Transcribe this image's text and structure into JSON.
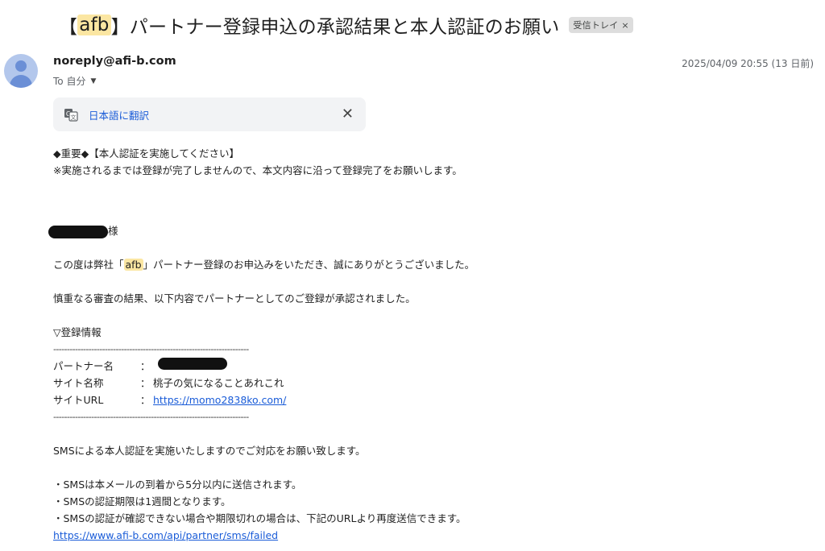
{
  "subject": {
    "prefix": "【",
    "highlight": "afb",
    "rest": "】パートナー登録申込の承認結果と本人認証のお願い",
    "label": "受信トレイ",
    "label_close": "×"
  },
  "sender": {
    "email": "noreply@afi-b.com",
    "to_label": "To 自分",
    "date": "2025/04/09 20:55 (13 日前)"
  },
  "translate": {
    "link_text": "日本語に翻訳",
    "close": "✕"
  },
  "body": {
    "line1": "◆重要◆【本人認証を実施してください】",
    "line2": "※実施されるまでは登録が完了しませんので、本文内容に沿って登録完了をお願いします。",
    "greeting_suffix": "様",
    "thanks_pre": "この度は弊社「",
    "thanks_hl": "afb",
    "thanks_post": "」パートナー登録のお申込みをいただき、誠にありがとうございました。",
    "approved": "慎重なる審査の結果、以下内容でパートナーとしてのご登録が承認されました。",
    "reg_header": "▽登録情報",
    "dashes": "------------------------------------------------------------------------",
    "rows": [
      {
        "key": "パートナー名",
        "sep": "：",
        "value": ""
      },
      {
        "key": "サイト名称",
        "sep": "：",
        "value": "桃子の気になることあれこれ"
      },
      {
        "key": "サイトURL",
        "sep": "：",
        "value": "https://momo2838ko.com/"
      }
    ],
    "sms_intro": "SMSによる本人認証を実施いたしますのでご対応をお願い致します。",
    "bullets": [
      "・SMSは本メールの到着から5分以内に送信されます。",
      "・SMSの認証期限は1週間となります。",
      "・SMSの認証が確認できない場合や期限切れの場合は、下記のURLより再度送信できます。"
    ],
    "resend_url": "https://www.afi-b.com/api/partner/sms/failed"
  }
}
